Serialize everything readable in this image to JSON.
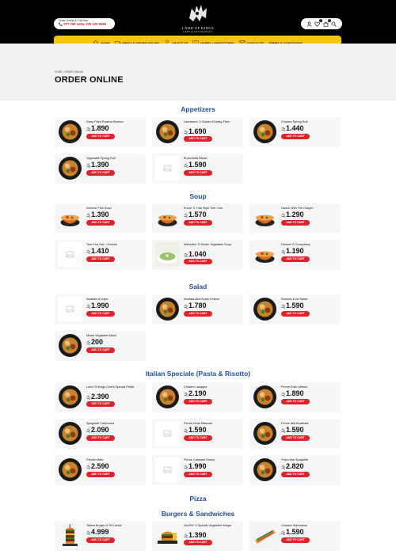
{
  "header": {
    "order_line1": "Order Online & Call Now",
    "order_line2": "📞 077 790 1264, 070 120 9099",
    "logo_name": "LAND OF KINGS",
    "logo_sub": "CAFE & RESTAURANT",
    "icons": [
      "user-icon",
      "heart-icon",
      "cart-icon",
      "search-icon"
    ],
    "wishlist_count": "0",
    "cart_count": "0"
  },
  "nav": [
    {
      "label": "HOME",
      "icon": "home-icon"
    },
    {
      "label": "MENU & ORDER ONLINE",
      "icon": "delivery-truck-icon"
    },
    {
      "label": "ABOUT US",
      "icon": "person-icon"
    },
    {
      "label": "HAPPY LAWNSITTERS",
      "icon": "reviews-icon"
    },
    {
      "label": "CONTACTS",
      "icon": "contact-icon"
    },
    {
      "label": "TERMS & CONDITIONS",
      "icon": ""
    }
  ],
  "breadcrumb": "HOME  /  ORDER ONLINE",
  "page_title": "ORDER ONLINE",
  "currency": "රු",
  "add_label": "ADD TO CART",
  "colors": {
    "accent": "#f8c414",
    "heading": "#1d4f9c",
    "button": "#e0232b"
  },
  "categories": [
    {
      "name": "Appetizers",
      "items": [
        {
          "name": "Deep Fried Prawns Wonton",
          "price": "1.890",
          "img": "plate"
        },
        {
          "name": "Lannisters' 3 Golden Cheesy Fries",
          "price": "1.690",
          "img": "plate"
        },
        {
          "name": "Chicken Spring Roll",
          "price": "1.440",
          "img": "plate"
        },
        {
          "name": "Vegetable Spring Roll",
          "price": "1.390",
          "img": "plate"
        },
        {
          "name": "Bruschetta Bread",
          "price": "1.590",
          "img": "placeholder"
        }
      ]
    },
    {
      "name": "Soup",
      "items": [
        {
          "name": "Gimmor Fish Soup",
          "price": "1.390",
          "img": "bowl"
        },
        {
          "name": "Euron' S Thai Style Tom Yum",
          "price": "1.570",
          "img": "bowl"
        },
        {
          "name": "Dance With The Dragon",
          "price": "1.290",
          "img": "bowl"
        },
        {
          "name": "Tom Kha Gai~ Chicken",
          "price": "1.410",
          "img": "placeholder"
        },
        {
          "name": "Winterfell' S Winter Vegetable Soup",
          "price": "1.040",
          "img": "soup-green"
        },
        {
          "name": "Dhorne' S Conspiracy",
          "price": "1.190",
          "img": "bowl"
        }
      ]
    },
    {
      "name": "Salad",
      "items": [
        {
          "name": "Insalata di polpo",
          "price": "1.990",
          "img": "placeholder"
        },
        {
          "name": "Insalata Alla Gusta Cesare",
          "price": "1.780",
          "img": "plate"
        },
        {
          "name": "Russian Cold Salad",
          "price": "1.590",
          "img": "plate"
        },
        {
          "name": "Mixed Vegitable Salad",
          "price": "200",
          "img": "plate"
        }
      ]
    },
    {
      "name": "Italian Speciale (Pasta & Risotto)",
      "items": [
        {
          "name": "Land Of Kings Chef's Special Pasta",
          "price": "2.390",
          "img": "plate"
        },
        {
          "name": "Chicken Lasagna",
          "price": "2.190",
          "img": "plate"
        },
        {
          "name": "Penne Pollo Alfredo",
          "price": "1.890",
          "img": "plate"
        },
        {
          "name": "Spaghetti Carbonara",
          "price": "2.090",
          "img": "plate"
        },
        {
          "name": "Penne Della Mascola",
          "price": "1.590",
          "img": "placeholder"
        },
        {
          "name": "Penne Alla Arrabiata",
          "price": "1.590",
          "img": "plate"
        },
        {
          "name": "Risotto Mare",
          "price": "2.590",
          "img": "plate"
        },
        {
          "name": "Penne Calamari Rosso",
          "price": "1.990",
          "img": "placeholder"
        },
        {
          "name": "Polpo Alla Spaghetti",
          "price": "2.820",
          "img": "plate"
        }
      ]
    },
    {
      "name": "Pizza",
      "items": []
    },
    {
      "name": "Burgers & Sandwiches",
      "items": [
        {
          "name": "Tallest Burger of Sri Lanka",
          "price": "4.999",
          "img": "burger"
        },
        {
          "name": "Hot Pie' S Special Vegetable Burger",
          "price": "1.390",
          "img": "burger-plate"
        },
        {
          "name": "Chicken Submarine",
          "price": "1.590",
          "img": "sub"
        }
      ]
    }
  ]
}
